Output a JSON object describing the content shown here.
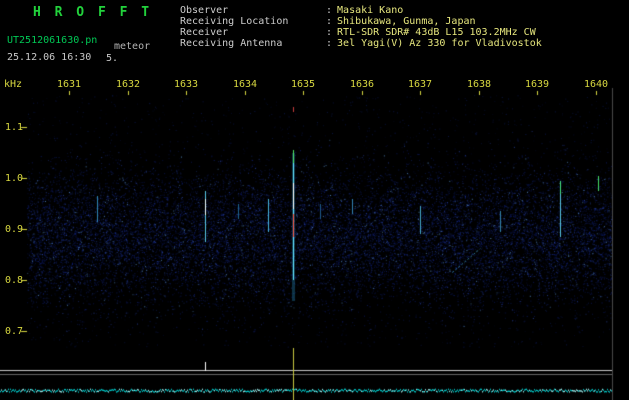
{
  "header": {
    "title": "H R O F F T",
    "filename": "UT2512061630.pn",
    "observation_name": "meteor",
    "datetime": "25.12.06 16:30",
    "datetime_extra": "5.",
    "colon": ":",
    "info": [
      {
        "label": "Observer",
        "value": "Masaki Kano"
      },
      {
        "label": "Receiving Location",
        "value": "Shibukawa, Gunma, Japan"
      },
      {
        "label": "Receiver",
        "value": "RTL-SDR SDR# 43dB L15 103.2MHz CW"
      },
      {
        "label": "Receiving Antenna",
        "value": "3el Yagi(V) Az 330 for Vladivostok"
      }
    ]
  },
  "axes": {
    "y_unit": "kHz",
    "time_labels": [
      "1631",
      "1632",
      "1633",
      "1634",
      "1635",
      "1636",
      "1637",
      "1638",
      "1639",
      "1640"
    ],
    "freq_labels": [
      "1.1",
      "1.0",
      "0.9",
      "0.8",
      "0.7"
    ],
    "freq_ticks_khz": [
      1.1,
      1.0,
      0.9,
      0.8,
      0.7
    ],
    "tick_color": "#d8d840"
  },
  "colors": {
    "background": "#000000",
    "title_green": "#22d23c",
    "filename_green": "#00c855",
    "text_white": "#c8c8c8",
    "value_yellow": "#e6e67d",
    "axis_yellow": "#d8d840",
    "noise_blue": "#182ea8",
    "trace_cyan": "#00c8c8"
  },
  "chart_data": {
    "type": "heatmap",
    "title": "HROFFT 10-minute meteor radio echo spectrogram",
    "x_range_minutes": [
      0,
      10
    ],
    "xtick_labels": [
      "1631",
      "1632",
      "1633",
      "1634",
      "1635",
      "1636",
      "1637",
      "1638",
      "1639",
      "1640"
    ],
    "ylabel": "kHz",
    "ytick_labels": [
      "1.1",
      "1.0",
      "0.9",
      "0.8",
      "0.7"
    ],
    "ylim": [
      0.669,
      1.163
    ],
    "noise_band_center_khz": 0.885,
    "echoes": [
      {
        "t": 1.2,
        "parts": [
          {
            "f_hi": 0.965,
            "f_lo": 0.915,
            "color": "#2f86b4",
            "w": 1
          }
        ]
      },
      {
        "t": 3.04,
        "parts": [
          {
            "f_hi": 0.975,
            "f_lo": 0.875,
            "color": "#59c8e6",
            "w": 1
          },
          {
            "f_hi": 0.96,
            "f_lo": 0.928,
            "color": "#eeffff",
            "w": 1
          }
        ]
      },
      {
        "t": 3.6,
        "parts": [
          {
            "f_hi": 0.95,
            "f_lo": 0.92,
            "color": "#1e6490",
            "w": 1
          }
        ]
      },
      {
        "t": 4.12,
        "parts": [
          {
            "f_hi": 0.96,
            "f_lo": 0.895,
            "color": "#46b4dc",
            "w": 1
          }
        ]
      },
      {
        "t": 4.55,
        "parts": [
          {
            "f_hi": 1.05,
            "f_lo": 0.76,
            "color": "#1e6e96",
            "w": 3,
            "a": 0.45
          },
          {
            "f_hi": 1.03,
            "f_lo": 0.8,
            "color": "#64e6ff",
            "w": 1
          },
          {
            "f_hi": 0.99,
            "f_lo": 0.94,
            "color": "#ffffff",
            "w": 1
          },
          {
            "f_hi": 0.93,
            "f_lo": 0.885,
            "color": "#ff5a46",
            "w": 1
          },
          {
            "f_hi": 1.055,
            "f_lo": 1.03,
            "color": "#50e664",
            "w": 1
          },
          {
            "f_hi": 1.14,
            "f_lo": 1.13,
            "color": "#c83c3c",
            "w": 1
          }
        ]
      },
      {
        "t": 5.0,
        "parts": [
          {
            "f_hi": 0.95,
            "f_lo": 0.92,
            "color": "#1e5a8c",
            "w": 1
          }
        ]
      },
      {
        "t": 5.56,
        "parts": [
          {
            "f_hi": 0.96,
            "f_lo": 0.93,
            "color": "#3282b4",
            "w": 1
          }
        ]
      },
      {
        "t": 6.72,
        "parts": [
          {
            "f_hi": 0.945,
            "f_lo": 0.89,
            "color": "#46aacc",
            "w": 1
          }
        ]
      },
      {
        "t": 8.08,
        "parts": [
          {
            "f_hi": 0.935,
            "f_lo": 0.895,
            "color": "#3282aa",
            "w": 1
          }
        ]
      },
      {
        "t": 9.11,
        "parts": [
          {
            "f_hi": 0.98,
            "f_lo": 0.885,
            "color": "#59c8e6",
            "w": 1
          },
          {
            "f_hi": 0.995,
            "f_lo": 0.968,
            "color": "#46e682",
            "w": 1
          }
        ]
      },
      {
        "t": 9.76,
        "parts": [
          {
            "f_hi": 1.005,
            "f_lo": 0.975,
            "color": "#46dc64",
            "w": 1
          }
        ]
      },
      {
        "t": 10.0,
        "parts": [
          {
            "f_hi": 1.0,
            "f_lo": 0.95,
            "color": "#d2ffd2",
            "w": 1
          }
        ]
      }
    ],
    "diagonal_trails": [
      {
        "t1": 7.27,
        "f1": 0.815,
        "t2": 7.75,
        "f2": 0.862,
        "color": "#3fa0c8"
      }
    ],
    "bottom_graph": {
      "upper_line_color": "#c8c8c8",
      "lower_line_color": "#666666",
      "trace_color": "#00c8c8",
      "markers": [
        {
          "t": 3.04,
          "style": "tick",
          "color": "#ffffff"
        },
        {
          "t": 4.55,
          "style": "full",
          "color": "#c8c840"
        }
      ]
    }
  }
}
